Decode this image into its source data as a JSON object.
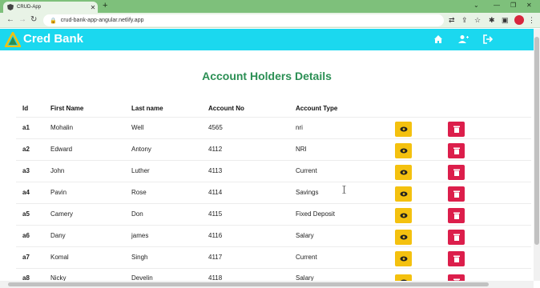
{
  "browser": {
    "tab_title": "CRUD-App",
    "url": "crud-bank-app-angular.netlify.app"
  },
  "app": {
    "brand": "Cred Bank",
    "page_title": "Account Holders Details"
  },
  "table": {
    "headers": [
      "Id",
      "First Name",
      "Last name",
      "Account No",
      "Account Type"
    ],
    "rows": [
      {
        "id": "a1",
        "first": "Mohalin",
        "last": "Well",
        "account_no": "4565",
        "type": "nri"
      },
      {
        "id": "a2",
        "first": "Edward",
        "last": "Antony",
        "account_no": "4112",
        "type": "NRI"
      },
      {
        "id": "a3",
        "first": "John",
        "last": "Luther",
        "account_no": "4113",
        "type": "Current"
      },
      {
        "id": "a4",
        "first": "Pavin",
        "last": "Rose",
        "account_no": "4114",
        "type": "Savings"
      },
      {
        "id": "a5",
        "first": "Camery",
        "last": "Don",
        "account_no": "4115",
        "type": "Fixed Deposit"
      },
      {
        "id": "a6",
        "first": "Dany",
        "last": "james",
        "account_no": "4116",
        "type": "Salary"
      },
      {
        "id": "a7",
        "first": "Komal",
        "last": "Singh",
        "account_no": "4117",
        "type": "Current"
      },
      {
        "id": "a8",
        "first": "Nicky",
        "last": "Develin",
        "account_no": "4118",
        "type": "Salary"
      }
    ]
  },
  "colors": {
    "header_bg": "#1bd8ef",
    "title": "#2b8f54",
    "view_button": "#f4c10f",
    "delete_button": "#dc1e4b"
  },
  "icons": {
    "header": [
      "home-icon",
      "add-user-icon",
      "logout-icon"
    ],
    "row_actions": [
      "eye-icon",
      "trash-icon"
    ]
  }
}
